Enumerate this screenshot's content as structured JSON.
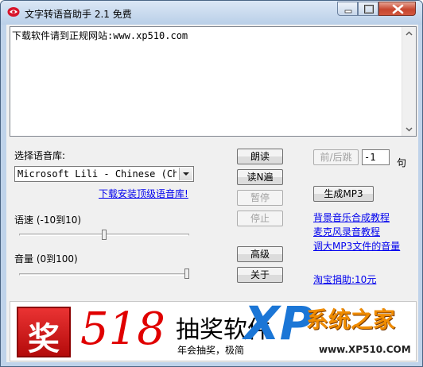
{
  "window": {
    "title": "文字转语音助手 2.1 免费",
    "icon": "app-icon",
    "controls": {
      "minimize": "minimize-icon",
      "maximize": "maximize-icon",
      "close": "close-icon"
    }
  },
  "editor": {
    "text": "下载软件请到正规网站:www.xp510.com"
  },
  "voice": {
    "label": "选择语音库:",
    "selected": "Microsoft Lili - Chinese (Chi",
    "download_link": "下载安装顶级语音库!"
  },
  "rate": {
    "label": "语速 (-10到10)",
    "value": 0,
    "min": -10,
    "max": 10
  },
  "volume": {
    "label": "音量 (0到100)",
    "value": 100,
    "min": 0,
    "max": 100
  },
  "buttons": {
    "read": "朗读",
    "read_n": "读N遍",
    "pause": "暂停",
    "stop": "停止",
    "advanced": "高级",
    "about": "关于",
    "prev_next": "前/后跳",
    "generate_mp3": "生成MP3"
  },
  "jump": {
    "value": "-1",
    "unit": "句"
  },
  "links": {
    "bg_music": "背景音乐合成教程",
    "mic_record": "麦克风录音教程",
    "mp3_volume": "调大MP3文件的音量",
    "donate": "淘宝捐助:10元"
  },
  "banner": {
    "logo_char": "奖",
    "number": "518",
    "title": "抽奖软件",
    "subtitle": "年会抽奖，极简"
  },
  "watermark": {
    "brand": "XP",
    "cn": "系统之家",
    "url": "www.XP510.COM"
  },
  "colors": {
    "link": "#0000ee",
    "banner_red": "#e00000",
    "watermark_blue": "#1b76d6",
    "watermark_orange": "#f08c00"
  }
}
